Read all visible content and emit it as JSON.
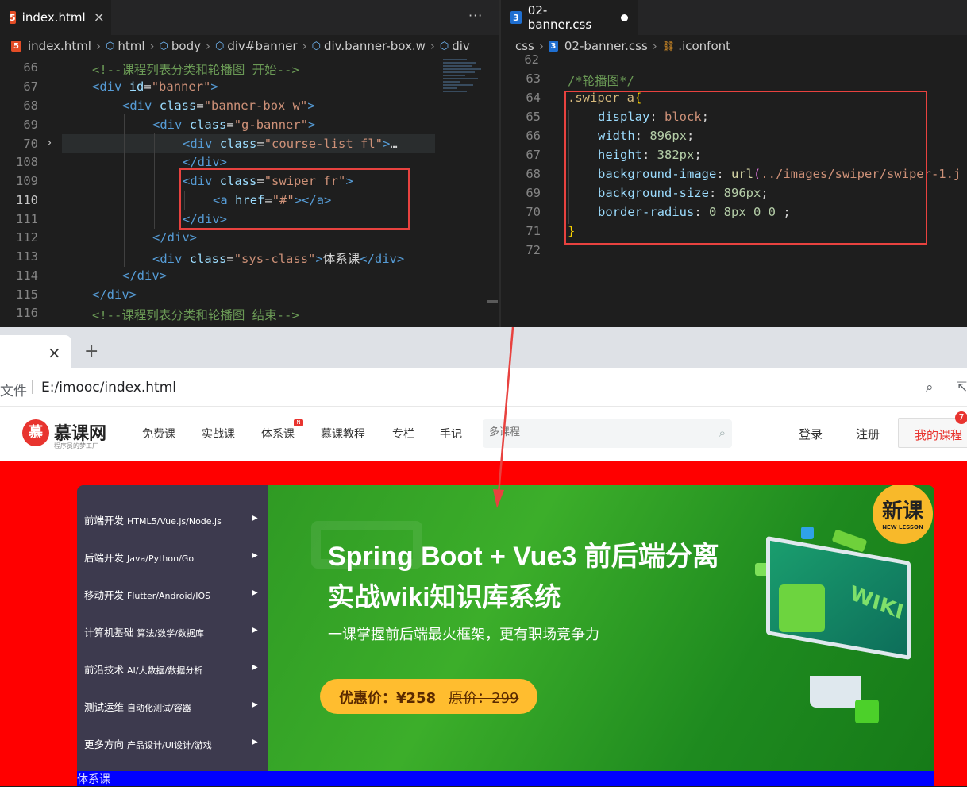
{
  "left_editor": {
    "tab_label": "index.html",
    "tab_icon": "5",
    "more": "···",
    "breadcrumb": [
      "index.html",
      "html",
      "body",
      "div#banner",
      "div.banner-box.w",
      "div"
    ],
    "lines": [
      {
        "n": "66"
      },
      {
        "n": "67"
      },
      {
        "n": "68"
      },
      {
        "n": "69"
      },
      {
        "n": "70"
      },
      {
        "n": "108"
      },
      {
        "n": "109"
      },
      {
        "n": "110"
      },
      {
        "n": "111"
      },
      {
        "n": "112"
      },
      {
        "n": "113"
      },
      {
        "n": "114"
      },
      {
        "n": "115"
      },
      {
        "n": "116"
      }
    ],
    "code": {
      "l66": "<!--课程列表分类和轮播图 开始-->",
      "l67_tag": "div",
      "l67_attr": "id",
      "l67_val": "\"banner\"",
      "l68_tag": "div",
      "l68_attr": "class",
      "l68_val": "\"banner-box w\"",
      "l69_tag": "div",
      "l69_attr": "class",
      "l69_val": "\"g-banner\"",
      "l70_tag": "div",
      "l70_attr": "class",
      "l70_val": "\"course-list fl\"",
      "l70_fold": "…",
      "l108_close": "div",
      "l109_tag": "div",
      "l109_attr": "class",
      "l109_val": "\"swiper fr\"",
      "l110_tag": "a",
      "l110_attr": "href",
      "l110_val": "\"#\"",
      "l110_close": "a",
      "l111_close": "div",
      "l112_close": "div",
      "l113_tag": "div",
      "l113_attr": "class",
      "l113_val": "\"sys-class\"",
      "l113_text": "体系课",
      "l113_close": "div",
      "l114_close": "div",
      "l115_close": "div",
      "l116": "<!--课程列表分类和轮播图 结束-->"
    }
  },
  "right_editor": {
    "tab_label": "02-banner.css",
    "tab_icon": "3",
    "breadcrumb": [
      "css",
      "02-banner.css",
      ".iconfont"
    ],
    "lines": [
      {
        "n": "62"
      },
      {
        "n": "63"
      },
      {
        "n": "64"
      },
      {
        "n": "65"
      },
      {
        "n": "66"
      },
      {
        "n": "67"
      },
      {
        "n": "68"
      },
      {
        "n": "69"
      },
      {
        "n": "70"
      },
      {
        "n": "71"
      },
      {
        "n": "72"
      }
    ],
    "code": {
      "l63": "/*轮播图*/",
      "l64_sel": ".swiper a",
      "l65_p": "display",
      "l65_v": "block",
      "l66_p": "width",
      "l66_v": "896px",
      "l67_p": "height",
      "l67_v": "382px",
      "l68_p": "background-image",
      "l68_fn": "url",
      "l68_arg": "../images/swiper/swiper-1.j",
      "l69_p": "background-size",
      "l69_v": "896px",
      "l70_p": "border-radius",
      "l70_v": "0 8px 0 0",
      "l71": "}"
    }
  },
  "browser": {
    "new_tab": "+",
    "close_tab": "×",
    "file_label": "文件",
    "url": "E:/imooc/index.html"
  },
  "site": {
    "logo_name": "慕课网",
    "logo_slogan": "程序员的梦工厂",
    "logo_mark": "慕",
    "nav": [
      "免费课",
      "实战课",
      "体系课",
      "慕课教程",
      "专栏",
      "手记"
    ],
    "nav_badge": "N",
    "search_placeholder": "多课程",
    "login": "登录",
    "register": "注册",
    "my_course": "我的课程",
    "my_course_count": "7",
    "categories": [
      {
        "main": "前端开发",
        "sub": "HTML5/Vue.js/Node.js"
      },
      {
        "main": "后端开发",
        "sub": "Java/Python/Go"
      },
      {
        "main": "移动开发",
        "sub": "Flutter/Android/IOS"
      },
      {
        "main": "计算机基础",
        "sub": "算法/数学/数据库"
      },
      {
        "main": "前沿技术",
        "sub": "AI/大数据/数据分析"
      },
      {
        "main": "测试运维",
        "sub": "自动化测试/容器"
      },
      {
        "main": "更多方向",
        "sub": "产品设计/UI设计/游戏"
      }
    ],
    "banner": {
      "title1": "Spring Boot + Vue3 前后端分离",
      "title2": "实战wiki知识库系统",
      "subtitle": "一课掌握前后端最火框架，更有职场竞争力",
      "price_label": "优惠价：¥258",
      "orig_label": "原价：299",
      "badge_big": "新课",
      "badge_small": "NEW LESSON",
      "wiki": "WIKI"
    },
    "sys_class": "体系课"
  },
  "colors": {
    "banner_bg": "#ff0000",
    "sys_class_bg": "#0000ff",
    "annotation": "#e8423f"
  }
}
